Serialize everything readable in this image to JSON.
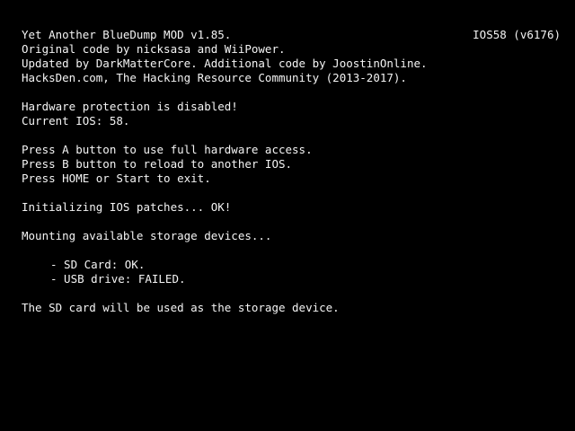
{
  "header": {
    "title": "Yet Another BlueDump MOD v1.85.",
    "ios_version": "IOS58 (v6176)",
    "credits_1": "Original code by nicksasa and WiiPower.",
    "credits_2": "Updated by DarkMatterCore. Additional code by JoostinOnline.",
    "credits_3": "HacksDen.com, The Hacking Resource Community (2013-2017)."
  },
  "status": {
    "hw_protection": "Hardware protection is disabled!",
    "current_ios": "Current IOS: 58."
  },
  "instructions": {
    "button_a": "Press A button to use full hardware access.",
    "button_b": "Press B button to reload to another IOS.",
    "button_home": "Press HOME or Start to exit."
  },
  "log": {
    "init_patches": "Initializing IOS patches... OK!",
    "mounting": "Mounting available storage devices...",
    "sd_card": "- SD Card: OK.",
    "usb_drive": "- USB drive: FAILED.",
    "storage_result": "The SD card will be used as the storage device."
  },
  "colors": {
    "background": "#000000",
    "text": "#f4f4f4"
  }
}
